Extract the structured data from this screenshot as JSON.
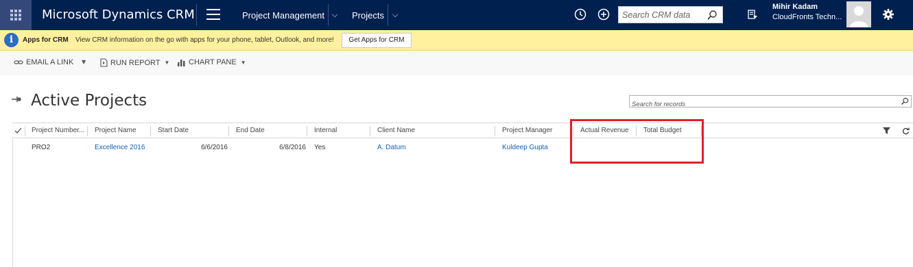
{
  "topbar": {
    "brand": "Microsoft Dynamics CRM",
    "area": "Project Management",
    "entity": "Projects",
    "search_placeholder": "Search CRM data",
    "user_name": "Mihir Kadam",
    "user_org": "CloudFronts Techn..."
  },
  "notification": {
    "title": "Apps for CRM",
    "message": "View CRM information on the go with apps for your phone, tablet, Outlook, and more!",
    "button": "Get Apps for CRM"
  },
  "commands": {
    "email_link": "EMAIL A LINK",
    "run_report": "RUN REPORT",
    "chart_pane": "CHART PANE"
  },
  "view": {
    "title": "Active Projects",
    "search_placeholder": "Search for records"
  },
  "grid": {
    "columns": [
      "Project Number...",
      "Project Name",
      "Start Date",
      "End Date",
      "Internal",
      "Client Name",
      "Project Manager",
      "Actual Revenue",
      "Total Budget"
    ],
    "rows": [
      {
        "project_number": "PRO2",
        "project_name": "Excellence 2016",
        "start_date": "6/6/2016",
        "end_date": "6/8/2016",
        "internal": "Yes",
        "client_name": "A. Datum",
        "project_manager": "Kuldeep Gupta",
        "actual_revenue": "",
        "total_budget": ""
      }
    ]
  },
  "colors": {
    "nav_bg": "#002050",
    "notif_bg": "#fff19d",
    "link": "#1160b7",
    "highlight": "#e01f26"
  }
}
